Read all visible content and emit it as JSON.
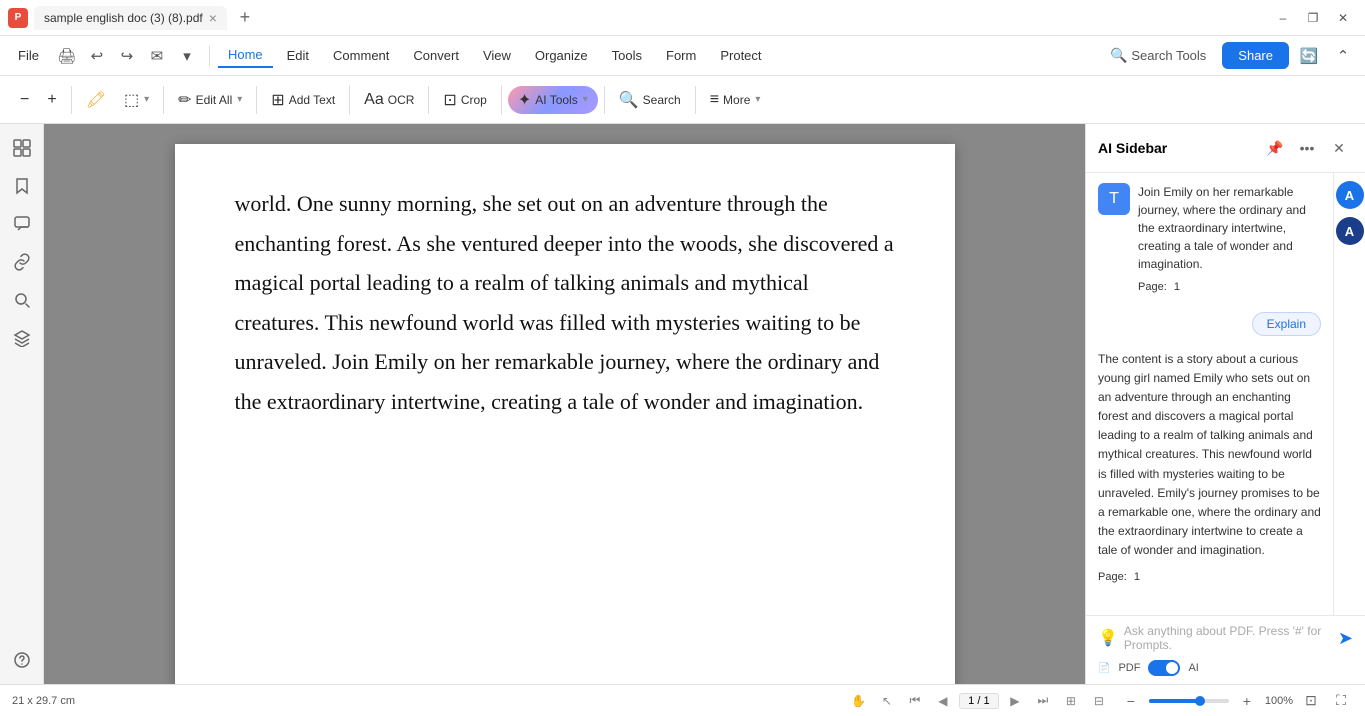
{
  "titleBar": {
    "appIcon": "P",
    "tabTitle": "sample english doc (3) (8).pdf",
    "tabClose": "×",
    "tabAdd": "+",
    "windowBtns": [
      "–",
      "□",
      "×"
    ]
  },
  "menuBar": {
    "file": "File",
    "items": [
      "Home",
      "Edit",
      "Comment",
      "Convert",
      "View",
      "Organize",
      "Tools",
      "Form",
      "Protect"
    ],
    "activeItem": "Home",
    "searchTools": "Search Tools",
    "share": "Share"
  },
  "toolbar": {
    "zoomOut": "−",
    "zoomIn": "+",
    "highlight": "✏",
    "selection": "⬚",
    "editAll": "Edit All",
    "addText": "Add Text",
    "ocr": "OCR",
    "crop": "Crop",
    "aiTools": "AI Tools",
    "search": "Search",
    "more": "More"
  },
  "leftSidebar": {
    "icons": [
      "□",
      "🔖",
      "💬",
      "🔗",
      "🔍",
      "⊞"
    ]
  },
  "pdfContent": {
    "text": "world. One sunny morning, she set out on an adventure through the enchanting forest. As she ventured deeper into the woods, she discovered a magical portal leading to a realm of talking animals and mythical creatures. This newfound world was filled with mysteries waiting to be unraveled. Join Emily on her remarkable journey, where the ordinary and the extraordinary intertwine, creating a tale of wonder and imagination."
  },
  "aiSidebar": {
    "title": "AI Sidebar",
    "introText": "Join Emily on her remarkable journey, where the ordinary and the extraordinary intertwine, creating a tale of wonder and imagination.",
    "pageLabel": "Page:",
    "pageNum": "1",
    "explainBtn": "Explain",
    "explanationText": "The content is a story about a curious young girl named Emily who sets out on an adventure through an enchanting forest and discovers a magical portal leading to a realm of talking animals and mythical creatures. This newfound world is filled with mysteries waiting to be unraveled. Emily's journey promises to be a remarkable one, where the ordinary and the extraordinary intertwine to create a tale of wonder and imagination.",
    "page2Label": "Page:",
    "page2Num": "1",
    "inputPlaceholder": "Ask anything about PDF. Press '#' for Prompts.",
    "togglePDF": "PDF",
    "toggleAI": "AI"
  },
  "statusBar": {
    "dimensions": "21 x 29.7 cm",
    "handTool": "✋",
    "selectTool": "↖",
    "prevPage": "◀",
    "firstPage": "⏮",
    "pageValue": "1 / 1",
    "nextPage": "▶",
    "lastPage": "⏭",
    "pageView": "⊞",
    "zoomMinus": "−",
    "zoomPlus": "+",
    "zoomValue": "100%",
    "fitPage": "⊡"
  }
}
